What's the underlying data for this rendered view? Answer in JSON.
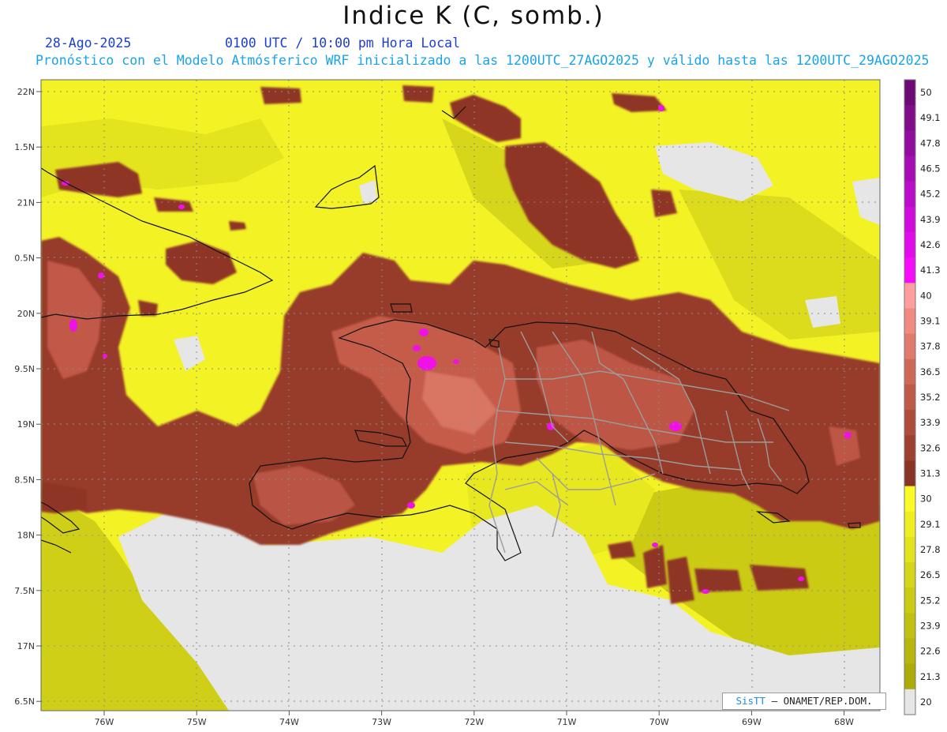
{
  "header": {
    "title": "Indice K (C, somb.)",
    "date": "28-Ago-2025",
    "time": "0100 UTC / 10:00 pm Hora Local",
    "forecast": "Pronóstico con el Modelo Atmósferico WRF inicializado a las 1200UTC_27AGO2025 y válido hasta las  1200UTC_29AGO2025"
  },
  "map": {
    "lat_labels": [
      "22N",
      "1.5N",
      "21N",
      "0.5N",
      "20N",
      "9.5N",
      "19N",
      "8.5N",
      "18N",
      "7.5N",
      "17N",
      "6.5N"
    ],
    "lon_labels": [
      "76W",
      "75W",
      "74W",
      "73W",
      "72W",
      "71W",
      "70W",
      "69W",
      "68W"
    ],
    "missing_color": "#e6e6e6"
  },
  "colorbar": {
    "labels": [
      "50",
      "49.1",
      "47.8",
      "46.5",
      "45.2",
      "43.9",
      "42.6",
      "41.3",
      "40",
      "39.1",
      "37.8",
      "36.5",
      "35.2",
      "33.9",
      "32.6",
      "31.3",
      "30",
      "29.1",
      "27.8",
      "26.5",
      "25.2",
      "23.9",
      "22.6",
      "21.3",
      "20"
    ],
    "colors": [
      "#6e0a75",
      "#7f0c8a",
      "#920c9f",
      "#a60cb4",
      "#bb0cc9",
      "#cf0cdc",
      "#e20ceb",
      "#f50cf8",
      "#ff9e9e",
      "#f08a82",
      "#e07a6c",
      "#d06858",
      "#bf5a48",
      "#ae4c3c",
      "#9c4032",
      "#8a3428",
      "#fafa28",
      "#eeee22",
      "#e2e21d",
      "#d6d618",
      "#cbcb14",
      "#c0c010",
      "#b6b60c",
      "#acac09",
      "#e6e6e6"
    ]
  },
  "credit": {
    "brand": "SisTT",
    "text": " – ONAMET/REP.DOM."
  }
}
